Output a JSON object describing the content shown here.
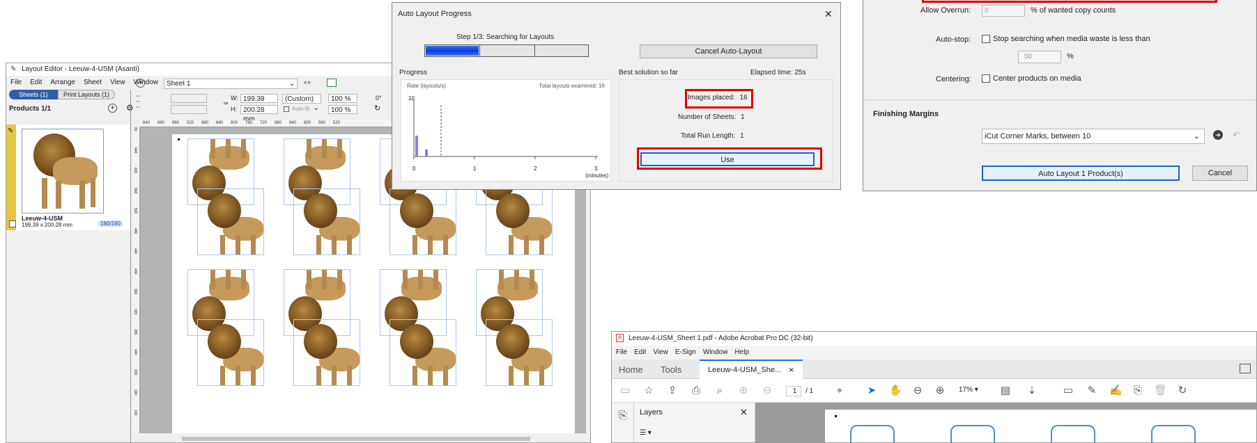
{
  "layout_editor": {
    "title": "Layout Editor - Leeuw-4-USM (Asanti)",
    "menu": [
      "File",
      "Edit",
      "Arrange",
      "Sheet",
      "View",
      "Window",
      "Help"
    ],
    "tabs": [
      "Sheets (1)",
      "Print Layouts (1)"
    ],
    "products_header": "Products 1/1",
    "sheet_select": "Sheet 1",
    "w_label": "W:",
    "w_value": "199.39 mm",
    "h_label": "H:",
    "h_value": "200.28 mm",
    "custom_select": "(Custom)",
    "scale_x": "100 %",
    "scale_y": "100 %",
    "rotation": "0°",
    "autofit": "Auto-fit",
    "product_name": "Leeuw-4-USM",
    "product_dims": "199.39 x 200.28 mm",
    "product_count": "160/160",
    "ruler_marks": [
      "840",
      "880",
      "960",
      "520",
      "880",
      "840",
      "800",
      "760",
      "720",
      "680",
      "640",
      "600",
      "560",
      "520"
    ],
    "left_ruler_marks": [
      "80",
      "640",
      "600",
      "560",
      "520",
      "480",
      "440",
      "400",
      "360",
      "320",
      "280",
      "240",
      "200",
      "160",
      "120"
    ]
  },
  "auto_layout_progress": {
    "title": "Auto Layout Progress",
    "step": "Step 1/3: Searching for Layouts",
    "cancel_button": "Cancel Auto-Layout",
    "progress_label": "Progress",
    "rate_label": "Rate (layouts/s)",
    "total_examined": "Total layouts examined: 16",
    "y_tick": "10",
    "x_ticks": [
      "0",
      "1",
      "2",
      "3"
    ],
    "x_unit": "(minutes)",
    "best_solution": "Best solution so far",
    "elapsed": "Elapsed time: 25s",
    "images_placed_label": "Images placed:",
    "images_placed_value": "16",
    "sheets_label": "Number of Sheets:",
    "sheets_value": "1",
    "run_length_label": "Total Run Length:",
    "run_length_value": "1",
    "use_button": "Use",
    "close_glyph": "✕"
  },
  "auto_layout_settings": {
    "allow_overrun_label": "Allow Overrun:",
    "allow_overrun_value": "0",
    "overrun_suffix": "% of wanted copy counts",
    "autostop_label": "Auto-stop:",
    "autostop_text": "Stop searching when media waste is less than",
    "autostop_value": "50",
    "autostop_suffix": "%",
    "centering_label": "Centering:",
    "centering_text": "Center products on media",
    "finishing_title": "Finishing Margins",
    "finishing_select": "iCut Corner Marks, between 10",
    "auto_button": "Auto Layout 1 Product(s)",
    "cancel_button": "Cancel"
  },
  "acrobat": {
    "title": "Leeuw-4-USM_Sheet 1.pdf - Adobe Acrobat Pro DC (32-bit)",
    "menu": [
      "File",
      "Edit",
      "View",
      "E-Sign",
      "Window",
      "Help"
    ],
    "home_tab": "Home",
    "tools_tab": "Tools",
    "doc_tab": "Leeuw-4-USM_She...",
    "doc_tab_close": "×",
    "page_current": "1",
    "page_total": "/ 1",
    "zoom": "17%",
    "layers_label": "Layers",
    "layers_close": "✕"
  },
  "colors": {
    "selection_red": "#e00000",
    "progress_blue": "#0a3fd8",
    "acrobat_blue": "#1473e6"
  }
}
